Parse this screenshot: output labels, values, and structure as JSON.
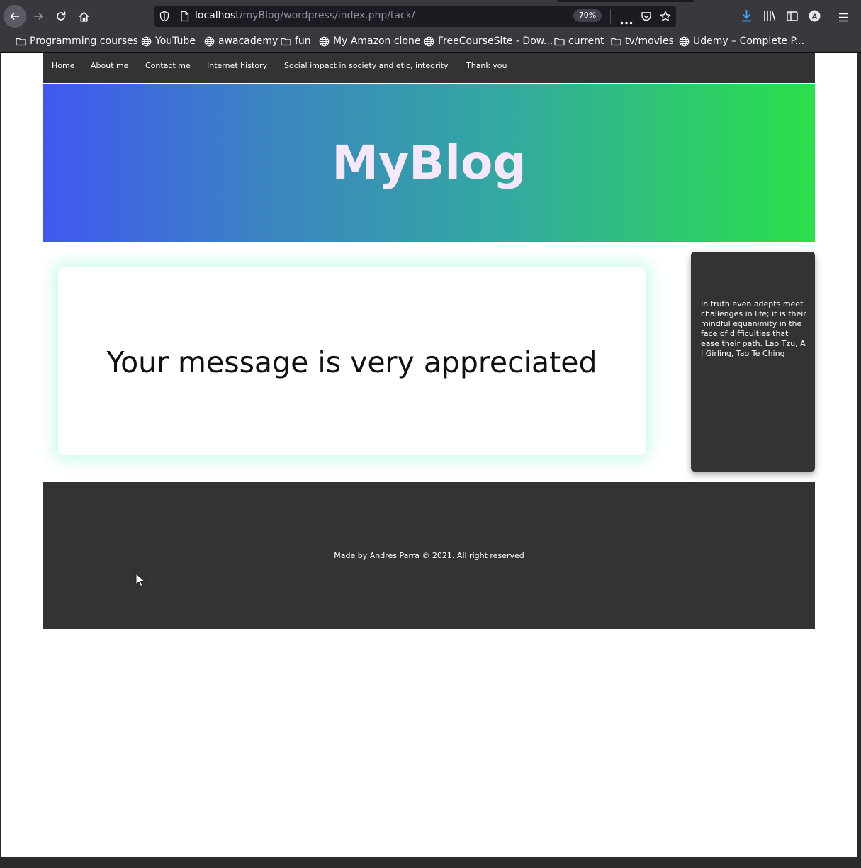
{
  "browser": {
    "url_host": "localhost",
    "url_path": "/myBlog/wordpress/index.php/tack/",
    "zoom": "70%",
    "profile_initial": "A",
    "bookmarks": [
      {
        "label": "Programming courses",
        "icon": "folder-icon"
      },
      {
        "label": "YouTube",
        "icon": "globe-icon"
      },
      {
        "label": "awacademy",
        "icon": "globe-icon"
      },
      {
        "label": "fun",
        "icon": "folder-icon"
      },
      {
        "label": "My Amazon clone",
        "icon": "globe-icon"
      },
      {
        "label": "FreeCourseSite - Dow...",
        "icon": "globe-icon"
      },
      {
        "label": "current",
        "icon": "folder-icon"
      },
      {
        "label": "tv/movies",
        "icon": "folder-icon"
      },
      {
        "label": "Udemy – Complete P...",
        "icon": "globe-icon"
      }
    ]
  },
  "site": {
    "nav": [
      {
        "label": "Home"
      },
      {
        "label": "About me"
      },
      {
        "label": "Contact me"
      },
      {
        "label": "Internet history"
      },
      {
        "label": "Social impact in society and etic, integrity"
      },
      {
        "label": "Thank you"
      }
    ],
    "title": "MyBlog",
    "message": "Your message is very appreciated",
    "quote": "In truth even adepts meet challenges in life; it is their mindful equanimity in the face of difficulties that ease their path. Lao Tzu, A J Girling, Tao Te Ching",
    "footer": "Made by Andres Parra © 2021. All right reserved"
  },
  "colors": {
    "gradient_start": "#4158f0",
    "gradient_end": "#2be04a",
    "title_color": "#f6e7fb",
    "dark_panel": "#333333",
    "card_glow": "#82f5c8"
  }
}
